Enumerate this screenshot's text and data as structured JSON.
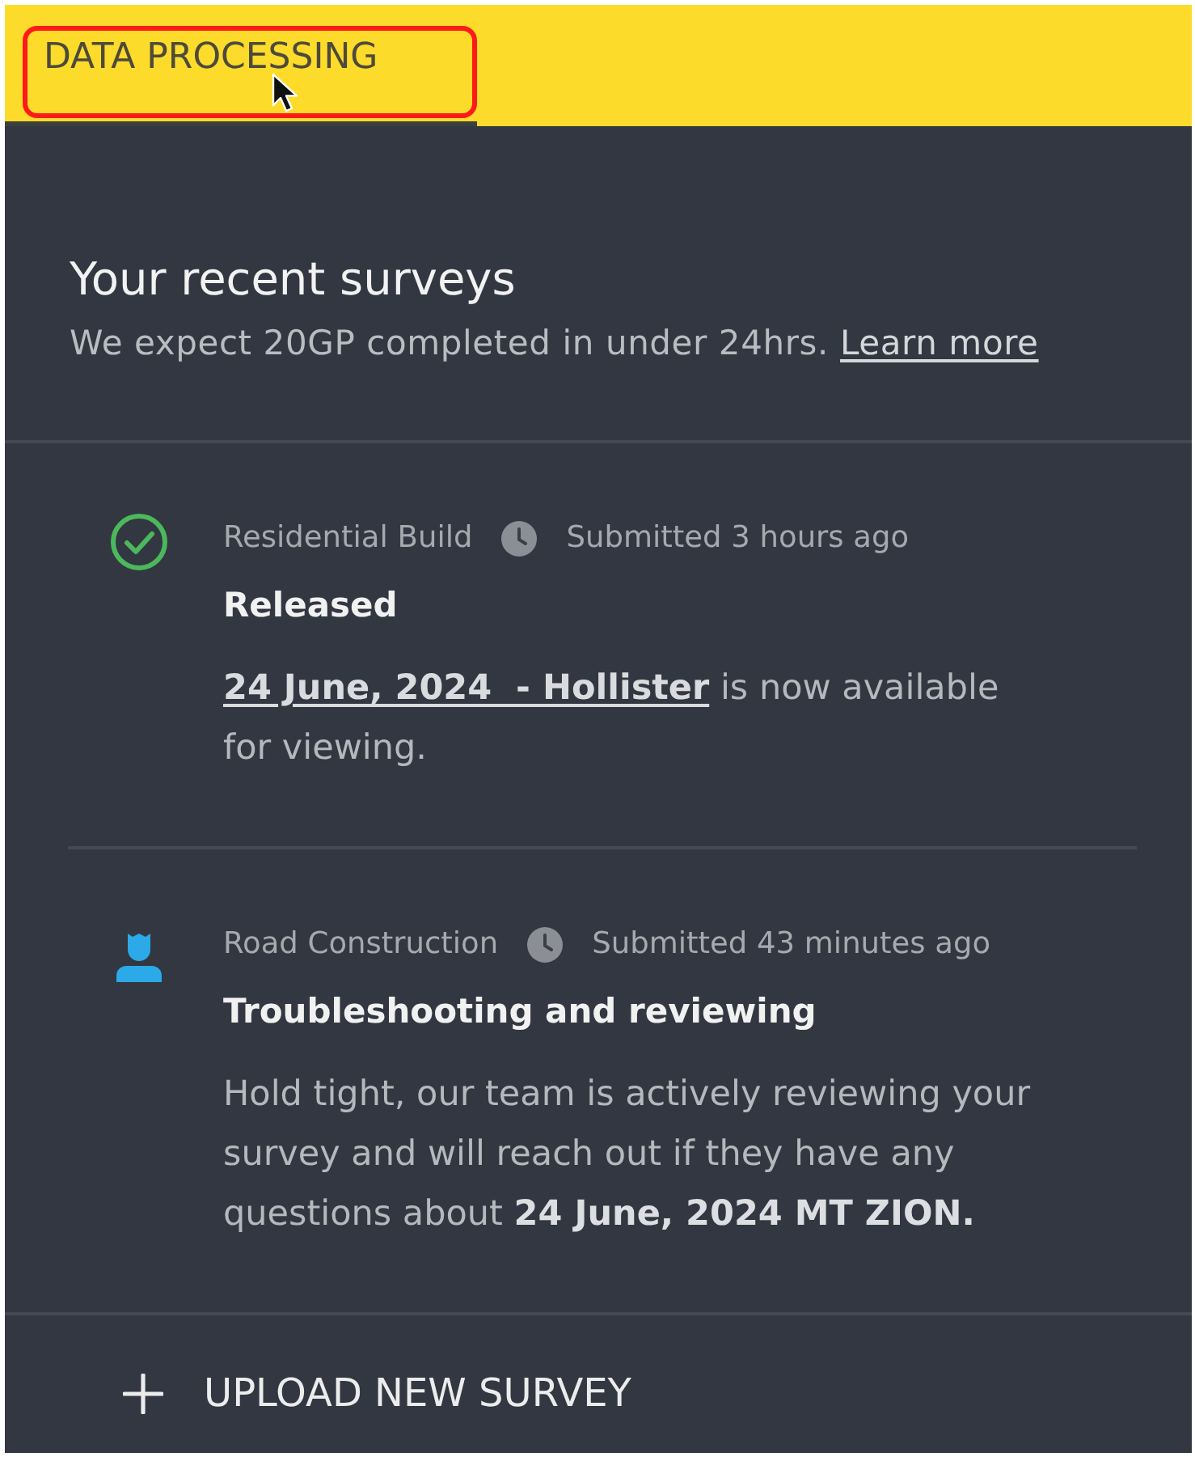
{
  "tabs": [
    {
      "label": "DATA PROCESSING",
      "selected": true,
      "highlighted": true
    }
  ],
  "intro": {
    "title": "Your recent surveys",
    "subtitle": "We expect 20GP completed in under 24hrs.",
    "link": "Learn more"
  },
  "surveys": [
    {
      "kind": "released",
      "category": "Residential Build",
      "submitted": "Submitted 3 hours ago",
      "status": "Released",
      "link": "24 June, 2024  - Hollister",
      "message": "is now available for viewing."
    },
    {
      "kind": "in_review",
      "category": "Road Construction",
      "submitted": "Submitted 43 minutes ago",
      "status": "Troubleshooting and reviewing",
      "message": "Hold tight, our team is actively reviewing your survey and will reach out if they have any questions about **24 June, 2024 MT ZION.**"
    }
  ],
  "upload_button": {
    "label": "UPLOAD NEW SURVEY"
  }
}
